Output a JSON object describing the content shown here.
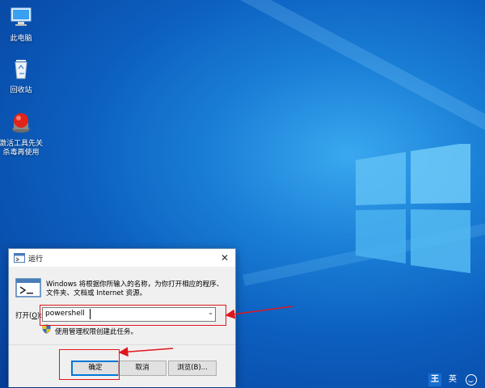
{
  "desktop": {
    "icons": [
      {
        "label": "此电脑"
      },
      {
        "label": "回收站"
      },
      {
        "label_line1": "激活工具先关",
        "label_line2": "杀毒再使用"
      }
    ]
  },
  "run_dialog": {
    "title": "运行",
    "close_glyph": "✕",
    "description_line1": "Windows 将根据你所输入的名称，为你打开相应的程序、",
    "description_line2": "文件夹、文档或 Internet 资源。",
    "open_label_prefix": "打开(",
    "open_label_hotkey": "O",
    "open_label_suffix": "):",
    "open_value": "powershell",
    "admin_note": "使用管理权限创建此任务。",
    "ok_label": "确定",
    "cancel_label": "取消",
    "browse_label": "浏览(B)..."
  },
  "tray": {
    "ime_king": "王",
    "ime_mode": "英"
  },
  "colors": {
    "highlight": "#e0161e",
    "accent": "#0078d7"
  },
  "icons": {
    "computer": "computer-icon",
    "recycle_bin": "recycle-bin-icon",
    "activation_tool": "activation-tool-icon",
    "run": "run-icon",
    "shield": "uac-shield-icon",
    "close": "close-icon",
    "dropdown": "chevron-down-icon"
  }
}
